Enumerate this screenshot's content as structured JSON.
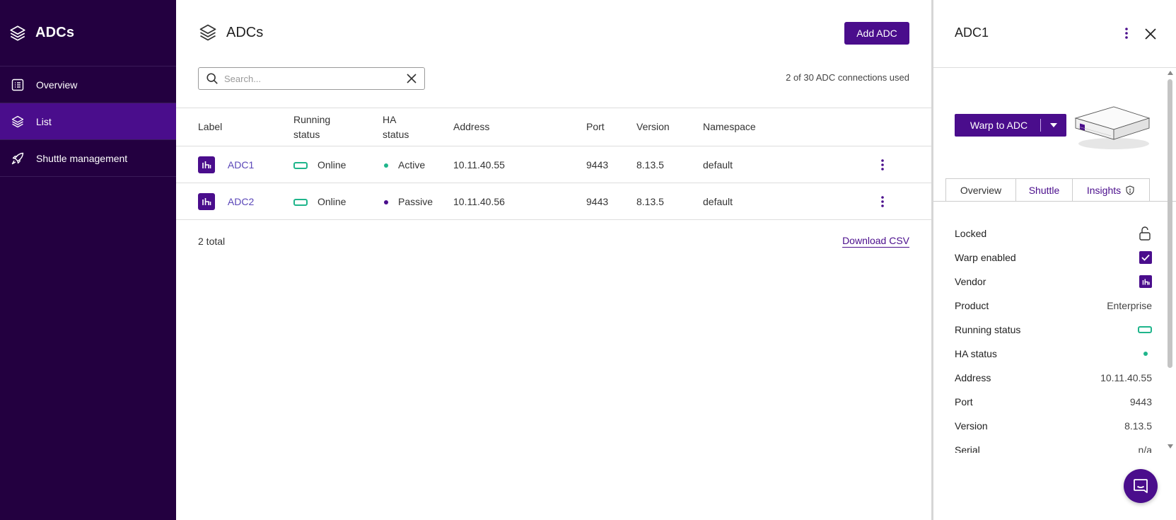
{
  "sidebar": {
    "title": "ADCs",
    "header_icon": "layers-icon",
    "items": [
      {
        "label": "Overview",
        "icon": "overview-list-icon",
        "active": false
      },
      {
        "label": "List",
        "icon": "layers-icon",
        "active": true
      },
      {
        "label": "Shuttle management",
        "icon": "rocket-icon",
        "active": false
      }
    ]
  },
  "main": {
    "title": "ADCs",
    "add_button": "Add ADC",
    "search": {
      "placeholder": "Search...",
      "value": ""
    },
    "usage": "2 of 30 ADC connections used",
    "columns": {
      "label": "Label",
      "running_1": "Running",
      "running_2": "status",
      "ha_1": "HA",
      "ha_2": "status",
      "address": "Address",
      "port": "Port",
      "version": "Version",
      "namespace": "Namespace"
    },
    "rows": [
      {
        "label": "ADC1",
        "running": "Online",
        "ha": "Active",
        "ha_color": "#1fb58b",
        "address": "10.11.40.55",
        "port": "9443",
        "version": "8.13.5",
        "namespace": "default"
      },
      {
        "label": "ADC2",
        "running": "Online",
        "ha": "Passive",
        "ha_color": "#4a0d8c",
        "address": "10.11.40.56",
        "port": "9443",
        "version": "8.13.5",
        "namespace": "default"
      }
    ],
    "total": "2 total",
    "download": "Download CSV"
  },
  "panel": {
    "title": "ADC1",
    "warp_button": "Warp to ADC",
    "tabs": [
      {
        "label": "Overview",
        "active": true
      },
      {
        "label": "Shuttle",
        "active": false
      },
      {
        "label": "Insights",
        "active": false
      }
    ],
    "props": {
      "locked": "Locked",
      "warp_enabled": "Warp enabled",
      "vendor": "Vendor",
      "product": "Product",
      "product_value": "Enterprise",
      "running_status": "Running status",
      "ha_status": "HA status",
      "address": "Address",
      "address_value": "10.11.40.55",
      "port": "Port",
      "port_value": "9443",
      "version": "Version",
      "version_value": "8.13.5",
      "serial": "Serial",
      "serial_value": "n/a"
    }
  },
  "colors": {
    "sidebar_bg": "#230040",
    "sidebar_active": "#4a0d8c",
    "accent": "#4a0d8c",
    "link": "#5a46b8",
    "online": "#1fb58b"
  }
}
